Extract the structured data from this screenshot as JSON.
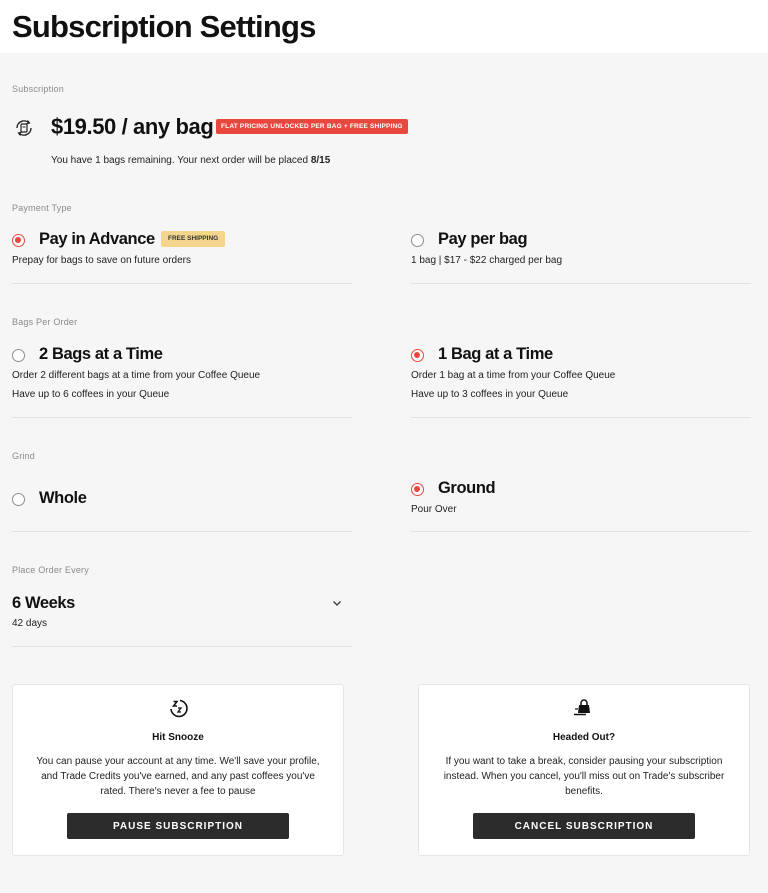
{
  "header": {
    "title": "Subscription Settings"
  },
  "subscription": {
    "label": "Subscription",
    "icon": "subscription-refresh-icon",
    "price": "$19.50 / any bag",
    "promo_badge": "FLAT PRICING UNLOCKED PER BAG + FREE SHIPPING",
    "remaining_prefix": "You have 1 bags remaining. Your next order will be placed ",
    "next_date": "8/15"
  },
  "payment_type": {
    "label": "Payment Type",
    "options": [
      {
        "title": "Pay in Advance",
        "badge": "FREE SHIPPING",
        "desc": "Prepay for bags to save on future orders",
        "selected": true
      },
      {
        "title": "Pay per bag",
        "desc": "1 bag | $17 - $22 charged per bag",
        "selected": false
      }
    ]
  },
  "bags_per_order": {
    "label": "Bags Per Order",
    "options": [
      {
        "title": "2 Bags at a Time",
        "desc": "Order 2 different bags at a time from your Coffee Queue",
        "desc2": "Have up to 6 coffees in your Queue",
        "selected": false
      },
      {
        "title": "1 Bag at a Time",
        "desc": "Order 1 bag at a time from your Coffee Queue",
        "desc2": "Have up to 3 coffees in your Queue",
        "selected": true
      }
    ]
  },
  "grind": {
    "label": "Grind",
    "options": [
      {
        "title": "Whole",
        "selected": false
      },
      {
        "title": "Ground",
        "desc": "Pour Over",
        "selected": true
      }
    ]
  },
  "frequency": {
    "label": "Place Order Every",
    "value": "6 Weeks",
    "days": "42 days",
    "icon": "chevron-down-icon"
  },
  "cards": {
    "snooze": {
      "icon": "snooze-icon",
      "title": "Hit Snooze",
      "text": "You can pause your account at any time. We'll save your profile, and Trade Credits you've earned, and any past coffees you've rated. There's never a fee to pause",
      "button": "PAUSE SUBSCRIPTION"
    },
    "cancel": {
      "icon": "departing-bag-icon",
      "title": "Headed Out?",
      "text": "If you want to take a break, consider pausing your subscription instead. When you cancel, you'll miss out on Trade's subscriber benefits.",
      "button": "CANCEL SUBSCRIPTION"
    }
  },
  "colors": {
    "accent": "#e8473e",
    "badge_free": "#f4d58c",
    "button_dark": "#2c2c2c",
    "background": "#f6f6f6"
  }
}
